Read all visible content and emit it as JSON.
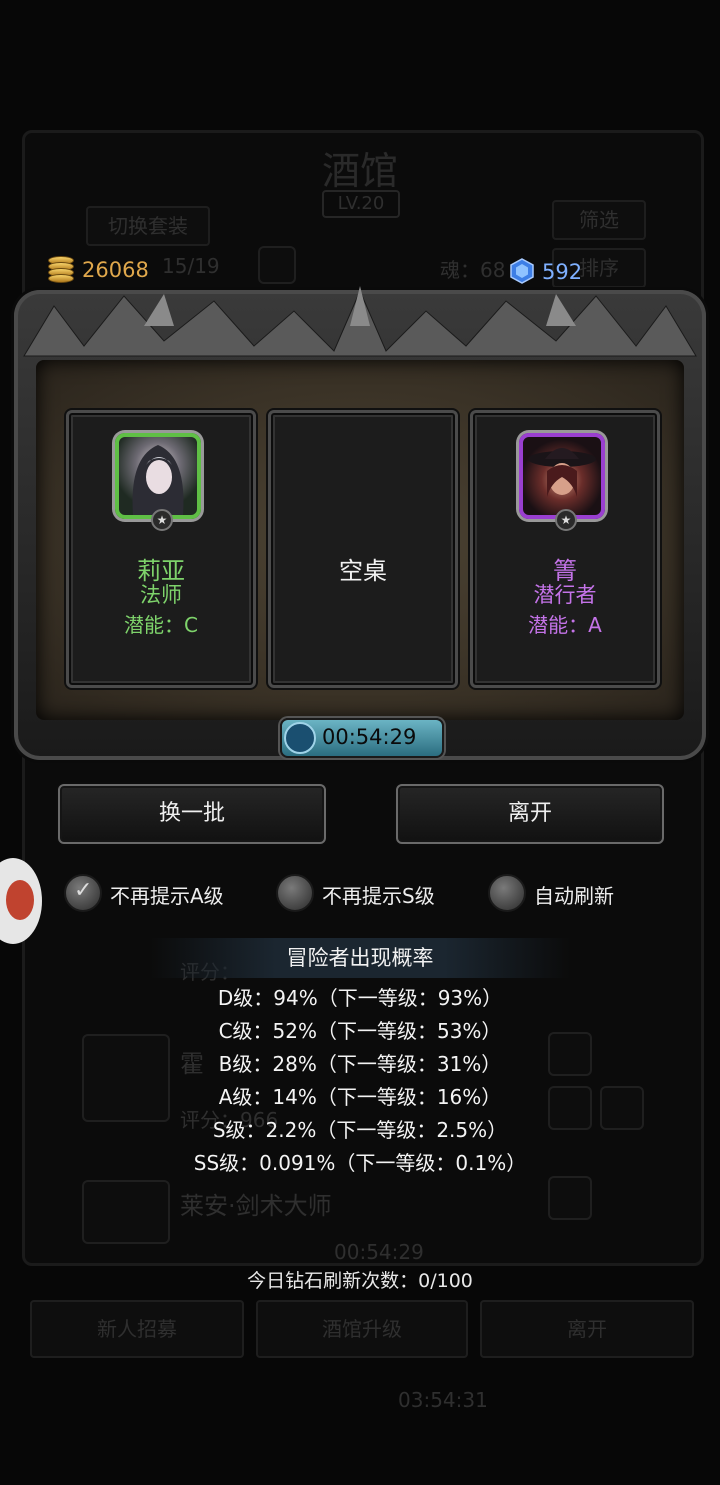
{
  "background": {
    "title": "酒馆",
    "level": "LV.20",
    "switch_outfit": "切换套装",
    "filter": "筛选",
    "sort": "排序",
    "capacity_label": "15/19",
    "soul_label": "魂：68",
    "bottom_buttons": [
      "新人招募",
      "酒馆升级",
      "离开"
    ],
    "hero_name_partial": "莱安·剑术大师",
    "hero_partial_2": "霍",
    "score_label_1": "评分：",
    "score_label_2": "评分：966",
    "timer": "00:54:29",
    "bottom_timer": "03:54:31"
  },
  "resources": {
    "gold": "26068",
    "gems": "592"
  },
  "cards": [
    {
      "type": "hero",
      "name": "莉亚",
      "class": "法师",
      "potential": "潜能：C",
      "tier": "green"
    },
    {
      "type": "empty",
      "label": "空桌"
    },
    {
      "type": "hero",
      "name": "箐",
      "class": "潜行者",
      "potential": "潜能：A",
      "tier": "purple"
    }
  ],
  "timer": "00:54:29",
  "actions": {
    "refresh": "换一批",
    "leave": "离开"
  },
  "options": [
    {
      "label": "不再提示A级",
      "checked": true
    },
    {
      "label": "不再提示S级",
      "checked": false
    },
    {
      "label": "自动刷新",
      "checked": false
    }
  ],
  "probability": {
    "title": "冒险者出现概率",
    "rows": [
      "D级：94%（下一等级：93%）",
      "C级：52%（下一等级：53%）",
      "B级：28%（下一等级：31%）",
      "A级：14%（下一等级：16%）",
      "S级：2.2%（下一等级：2.5%）",
      "SS级：0.091%（下一等级：0.1%）"
    ]
  },
  "daily_refresh": "今日钻石刷新次数：0/100",
  "colors": {
    "gold": "#e0a84c",
    "gem": "#7fb0ff",
    "green_tier": "#7ed36b",
    "purple_tier": "#c473e8"
  }
}
